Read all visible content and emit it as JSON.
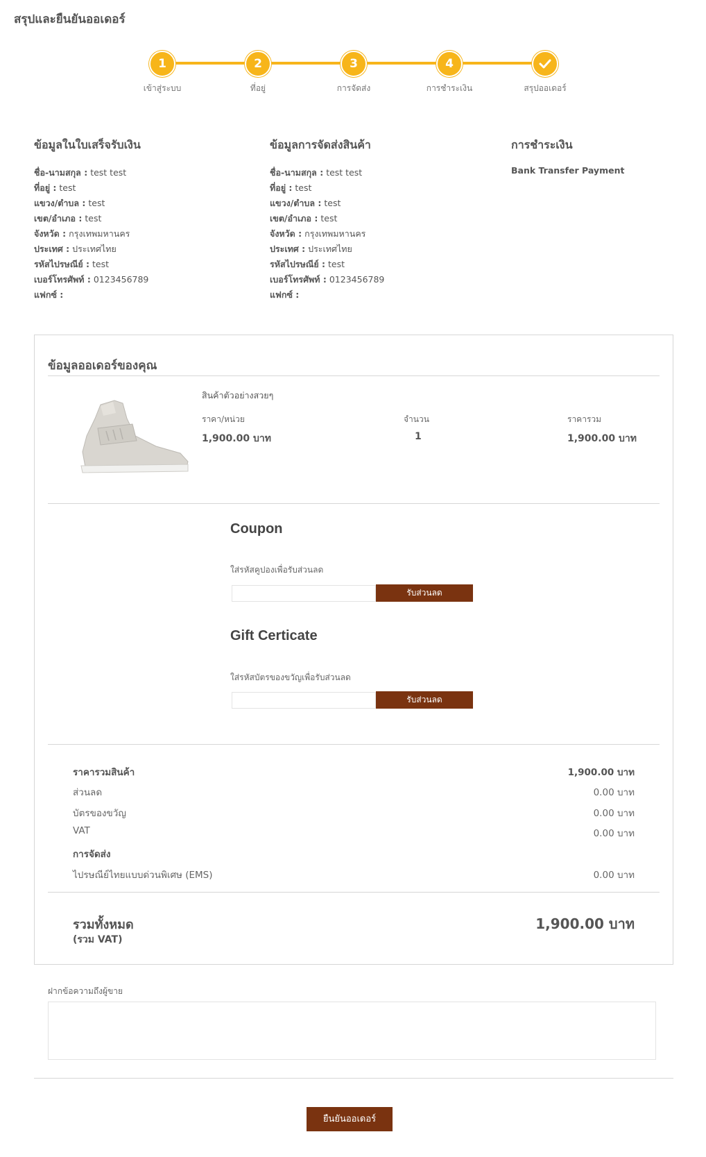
{
  "page_title": "สรุปและยืนยันออเดอร์",
  "accent_color": "#f7b51a",
  "button_color": "#7a3310",
  "steps": [
    {
      "number": "1",
      "label": "เข้าสู่ระบบ"
    },
    {
      "number": "2",
      "label": "ที่อยู่"
    },
    {
      "number": "3",
      "label": "การจัดส่ง"
    },
    {
      "number": "4",
      "label": "การชำระเงิน"
    },
    {
      "number": "",
      "icon": "check-icon",
      "label": "สรุปออเดอร์"
    }
  ],
  "billing": {
    "heading": "ข้อมูลในใบเสร็จรับเงิน",
    "rows": [
      {
        "label": "ชื่อ-นามสกุล :",
        "value": "test test"
      },
      {
        "label": "ที่อยู่ :",
        "value": "test"
      },
      {
        "label": "แขวง/ตำบล :",
        "value": "test"
      },
      {
        "label": "เขต/อำเภอ :",
        "value": "test"
      },
      {
        "label": "จังหวัด :",
        "value": "กรุงเทพมหานคร"
      },
      {
        "label": "ประเทศ :",
        "value": "ประเทศไทย"
      },
      {
        "label": "รหัสไปรษณีย์ :",
        "value": "test"
      },
      {
        "label": "เบอร์โทรศัพท์ :",
        "value": "0123456789"
      },
      {
        "label": "แฟกซ์ :",
        "value": ""
      }
    ]
  },
  "shipping": {
    "heading": "ข้อมูลการจัดส่งสินค้า",
    "rows": [
      {
        "label": "ชื่อ-นามสกุล :",
        "value": "test test"
      },
      {
        "label": "ที่อยู่ :",
        "value": "test"
      },
      {
        "label": "แขวง/ตำบล :",
        "value": "test"
      },
      {
        "label": "เขต/อำเภอ :",
        "value": "test"
      },
      {
        "label": "จังหวัด :",
        "value": "กรุงเทพมหานคร"
      },
      {
        "label": "ประเทศ :",
        "value": "ประเทศไทย"
      },
      {
        "label": "รหัสไปรษณีย์ :",
        "value": "test"
      },
      {
        "label": "เบอร์โทรศัพท์ :",
        "value": "0123456789"
      },
      {
        "label": "แฟกซ์ :",
        "value": ""
      }
    ]
  },
  "payment": {
    "heading": "การชำระเงิน",
    "method": "Bank Transfer Payment"
  },
  "order": {
    "title": "ข้อมูลออเดอร์ของคุณ",
    "product_name": "สินค้าตัวอย่างสวยๆ",
    "unit_price_label": "ราคา/หน่วย",
    "unit_price": "1,900.00 บาท",
    "qty_label": "จำนวน",
    "qty": "1",
    "total_label": "ราคารวม",
    "total": "1,900.00 บาท"
  },
  "coupon": {
    "heading": "Coupon",
    "label": "ใส่รหัสคูปองเพื่อรับส่วนลด",
    "value": "",
    "button": "รับส่วนลด"
  },
  "gift": {
    "heading": "Gift Certicate",
    "label": "ใส่รหัสบัตรของขวัญเพื่อรับส่วนลด",
    "value": "",
    "button": "รับส่วนลด"
  },
  "summary": {
    "subtotal_label": "ราคารวมสินค้า",
    "subtotal": "1,900.00 บาท",
    "discount_label": "ส่วนลด",
    "discount": "0.00 บาท",
    "gift_label": "บัตรของขวัญ",
    "gift": "0.00 บาท",
    "vat_label": "VAT",
    "vat": "0.00 บาท",
    "shipping_label": "การจัดส่ง",
    "shipping_method": "ไปรษณีย์ไทยแบบด่วนพิเศษ (EMS)",
    "shipping_cost": "0.00 บาท",
    "grand_label": "รวมทั้งหมด",
    "grand_sub": "(รวม VAT)",
    "grand_total": "1,900.00 บาท"
  },
  "note": {
    "label": "ฝากข้อความถึงผู้ขาย",
    "value": ""
  },
  "confirm_button": "ยืนยันออเดอร์"
}
